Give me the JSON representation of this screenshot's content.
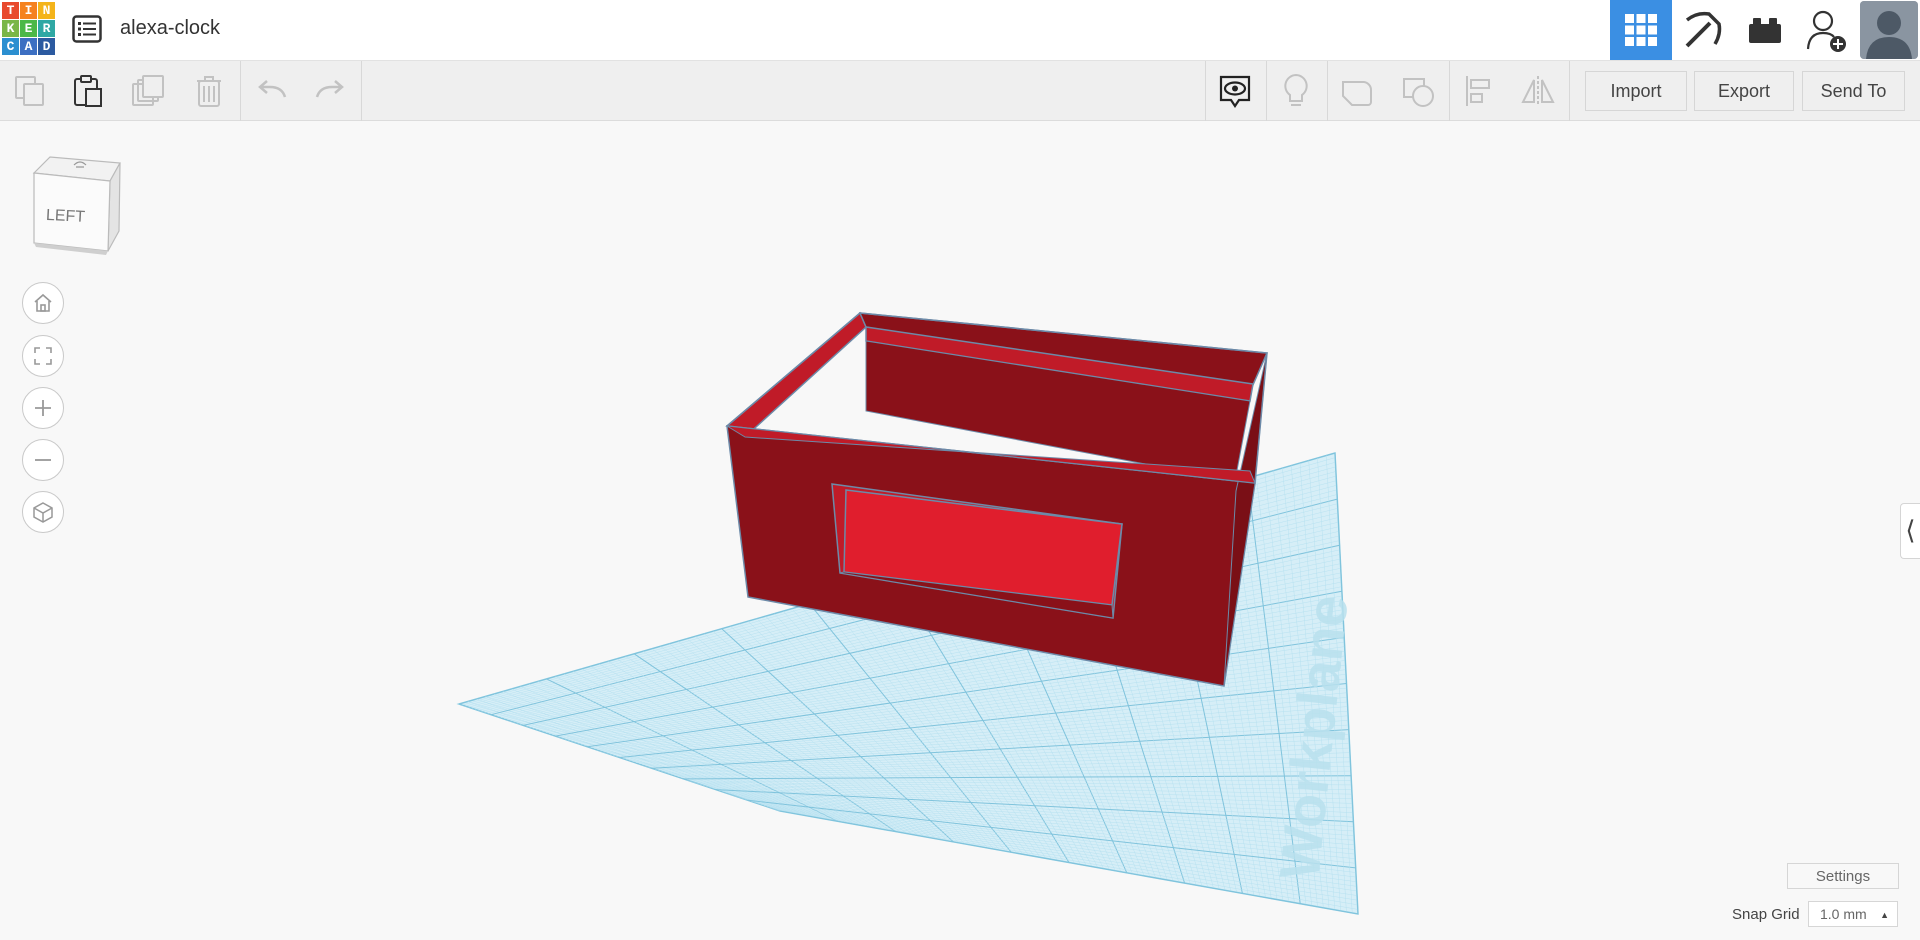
{
  "app": {
    "logo_letters": [
      "T",
      "I",
      "N",
      "K",
      "E",
      "R",
      "C",
      "A",
      "D"
    ],
    "logo_colors": [
      "#e8492d",
      "#f5821f",
      "#f4b41a",
      "#7ab648",
      "#4cb848",
      "#2fa8a4",
      "#2b8fd0",
      "#3c6fc2",
      "#2c5aa0"
    ]
  },
  "header": {
    "design_title": "alexa-clock",
    "accent_color": "#3b8fe3",
    "icons": [
      "menu-list-icon",
      "grid-view-icon",
      "pickaxe-icon",
      "bricks-icon",
      "add-user-icon",
      "avatar"
    ]
  },
  "toolbar": {
    "icons_left": [
      "copy-icon",
      "paste-icon",
      "duplicate-icon",
      "delete-icon",
      "undo-icon",
      "redo-icon"
    ],
    "icons_right": [
      "show-notes-icon",
      "light-bulb-icon",
      "group-icon",
      "ungroup-icon",
      "align-icon",
      "mirror-icon"
    ],
    "import_label": "Import",
    "export_label": "Export",
    "send_to_label": "Send To"
  },
  "viewcube": {
    "face_label": "LEFT"
  },
  "nav": [
    "home-icon",
    "fit-view-icon",
    "zoom-in-icon",
    "zoom-out-icon",
    "perspective-icon"
  ],
  "workplane": {
    "label": "Workplane",
    "color": "#9ed6ea"
  },
  "model": {
    "colors": {
      "outer": "#8a1119",
      "inner": "#c01b28",
      "window": "#e01e2d"
    }
  },
  "footer": {
    "settings_label": "Settings",
    "snap_grid_label": "Snap Grid",
    "snap_grid_value": "1.0 mm"
  },
  "panel": {
    "toggle_glyph": "⟨"
  }
}
